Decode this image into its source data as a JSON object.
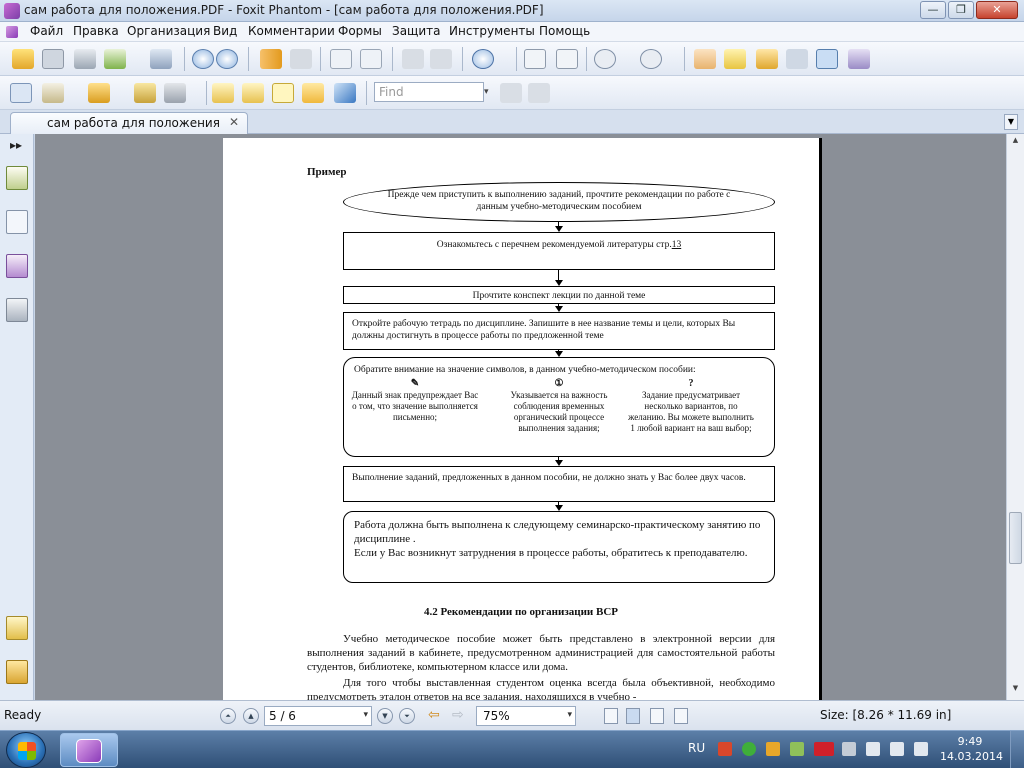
{
  "window": {
    "title": "сам работа для положения.PDF - Foxit Phantom - [сам работа для положения.PDF]",
    "controls": [
      "—",
      "❐",
      "✕"
    ]
  },
  "menu": [
    "Файл",
    "Правка",
    "Организация",
    "Вид",
    "Комментарии",
    "Формы",
    "Защита",
    "Инструменты",
    "Помощь"
  ],
  "toolbar": {
    "find_placeholder": "Find",
    "find_dropdown": "▾"
  },
  "tab": {
    "label": "сам работа для положения",
    "close": "✕",
    "dropdown": "▼"
  },
  "left_panel": {
    "collapse": "▸▸"
  },
  "document": {
    "example_label": "Пример",
    "oval_text": "Прежде чем приступить к выполнению заданий, прочтите рекомендации по работе с данным учебно-методическим пособием",
    "box1_text": "Ознакомьтесь с перечнем рекомендуемой литературы стр.",
    "box1_link": "13",
    "box2_text": "Прочтите конспект лекции по данной теме",
    "box3_text": "Откройте рабочую тетрадь по дисциплине. Запишите в нее название темы и цели, которых Вы должны достигнуть в процессе работы по предложенной теме",
    "box4_intro": "Обратите внимание на значение символов, в данном учебно-методическом пособии:",
    "symbols": [
      {
        "sym": "✎",
        "text": "Данный знак предупреждает Вас о том, что значение выполняется письменно;"
      },
      {
        "sym": "①",
        "text": "Указывается на важность соблюдения временных органический процессе выполнения задания;"
      },
      {
        "sym": "?",
        "text": "Задание предусматривает несколько вариантов, по желанию. Вы можете выполнить 1 любой вариант на ваш выбор;"
      }
    ],
    "box5_text": "Выполнение заданий, предложенных в данном пособии, не должно знать у Вас более двух часов.",
    "box6_line1": "Работа должна быть выполнена к следующему семинарско-практическому занятию по дисциплине .",
    "box6_line2": "Если у Вас возникнут затруднения в процессе работы, обратитесь к преподавателю.",
    "section_heading": "4.2 Рекомендации по организации ВСР",
    "para1": "Учебно методическое пособие может быть представлено в электронной версии для выполнения заданий в кабинете, предусмотренном администрацией для самостоятельной работы студентов, библиотеке, компьютерном классе или дома.",
    "para2": "Для того чтобы выставленная студентом оценка всегда была объективной, необходимо предусмотреть эталон ответов на все задания, находящихся в учебно -"
  },
  "statusbar": {
    "ready": "Ready",
    "page_value": "5 / 6",
    "zoom_value": "75%",
    "size": "Size: [8.26 * 11.69 in]",
    "dropdown": "▾"
  },
  "taskbar": {
    "lang": "RU",
    "time": "9:49",
    "date": "14.03.2014"
  },
  "colors": {
    "accent": "#3a6ea5",
    "app_purple": "#8a3bb8",
    "doc_background": "#8a8f97"
  }
}
